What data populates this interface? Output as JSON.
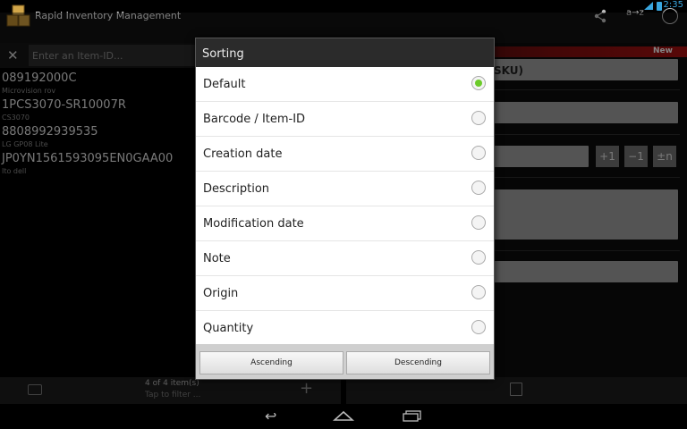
{
  "status": {
    "time": "2:35"
  },
  "app": {
    "title": "Rapid Inventory Management",
    "sort_label": "a→z"
  },
  "search": {
    "placeholder": "Enter an Item-ID..."
  },
  "items": [
    {
      "id": "089192000C",
      "sub": "Microvision rov"
    },
    {
      "id": "1PCS3070-SR10007R",
      "sub": "CS3070"
    },
    {
      "id": "8808992939535",
      "sub": "LG GP08 Lite"
    },
    {
      "id": "JP0YN1561593095EN0GAA00",
      "sub": "Ito dell"
    }
  ],
  "bottom": {
    "count": "4 of 4 item(s)",
    "filter": "Tap to filter ..."
  },
  "detail": {
    "badge": "New",
    "sku_hint": "SKU)",
    "qty_buttons": [
      "+1",
      "−1",
      "±n"
    ]
  },
  "dialog": {
    "title": "Sorting",
    "options": [
      {
        "label": "Default",
        "selected": true
      },
      {
        "label": "Barcode / Item-ID",
        "selected": false
      },
      {
        "label": "Creation date",
        "selected": false
      },
      {
        "label": "Description",
        "selected": false
      },
      {
        "label": "Modification date",
        "selected": false
      },
      {
        "label": "Note",
        "selected": false
      },
      {
        "label": "Origin",
        "selected": false
      },
      {
        "label": "Quantity",
        "selected": false
      }
    ],
    "ascending": "Ascending",
    "descending": "Descending"
  },
  "colors": {
    "accent": "#3aa7e0",
    "selected_radio": "#6ccb2a",
    "new_strip": "#a01010"
  }
}
